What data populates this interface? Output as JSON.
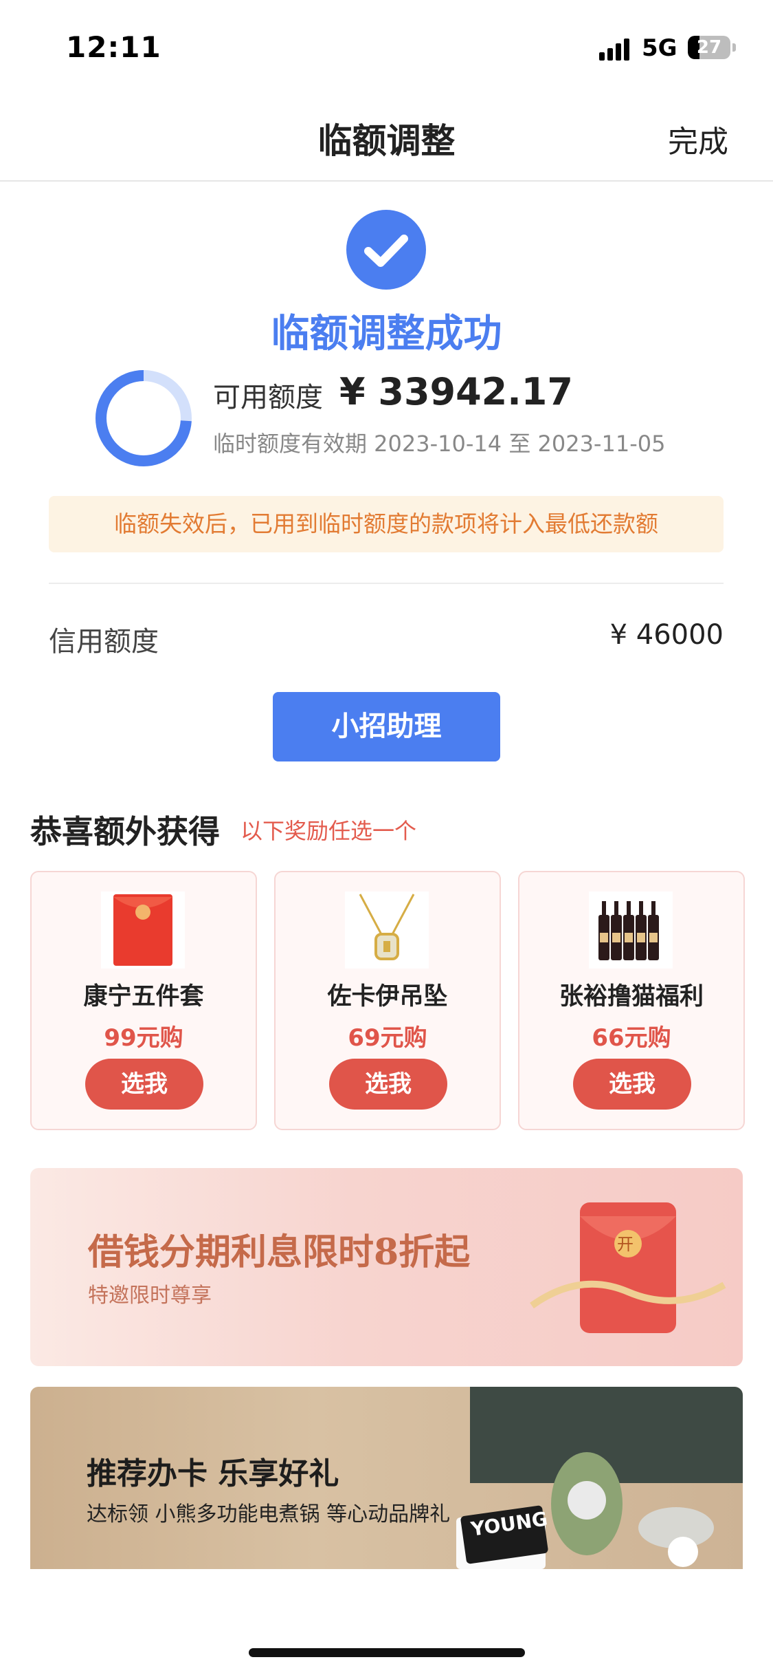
{
  "status_bar": {
    "time": "12:11",
    "network": "5G",
    "battery": "27",
    "battery_level": 0.27
  },
  "nav": {
    "title": "临额调整",
    "done": "完成"
  },
  "result": {
    "title": "临额调整成功",
    "available_label": "可用额度",
    "available_value": "¥ 33942.17",
    "validity": "临时额度有效期 2023-10-14 至 2023-11-05",
    "ring_fraction": 0.74
  },
  "notice": "临额失效后，已用到临时额度的款项将计入最低还款额",
  "credit": {
    "label": "信用额度",
    "value": "¥ 46000"
  },
  "assistant_button": "小招助理",
  "rewards": {
    "title": "恭喜额外获得",
    "subtitle": "以下奖励任选一个",
    "items": [
      {
        "name": "康宁五件套",
        "price": "99元购",
        "button": "选我",
        "icon": "red-envelope-icon"
      },
      {
        "name": "佐卡伊吊坠",
        "price": "69元购",
        "button": "选我",
        "icon": "gold-pendant-icon"
      },
      {
        "name": "张裕撸猫福利",
        "price": "66元购",
        "button": "选我",
        "icon": "wine-bottles-icon"
      }
    ]
  },
  "banner_loan": {
    "title": "借钱分期利息限时8折起",
    "subtitle": "特邀限时尊享",
    "envelope_char": "开"
  },
  "banner_card": {
    "title": "推荐办卡 乐享好礼",
    "subtitle": "达标领 小熊多功能电煮锅 等心动品牌礼",
    "card_text": "YOUNG"
  },
  "colors": {
    "accent": "#4b7ef0",
    "warning": "#e27b33",
    "reward": "#e0554a"
  }
}
